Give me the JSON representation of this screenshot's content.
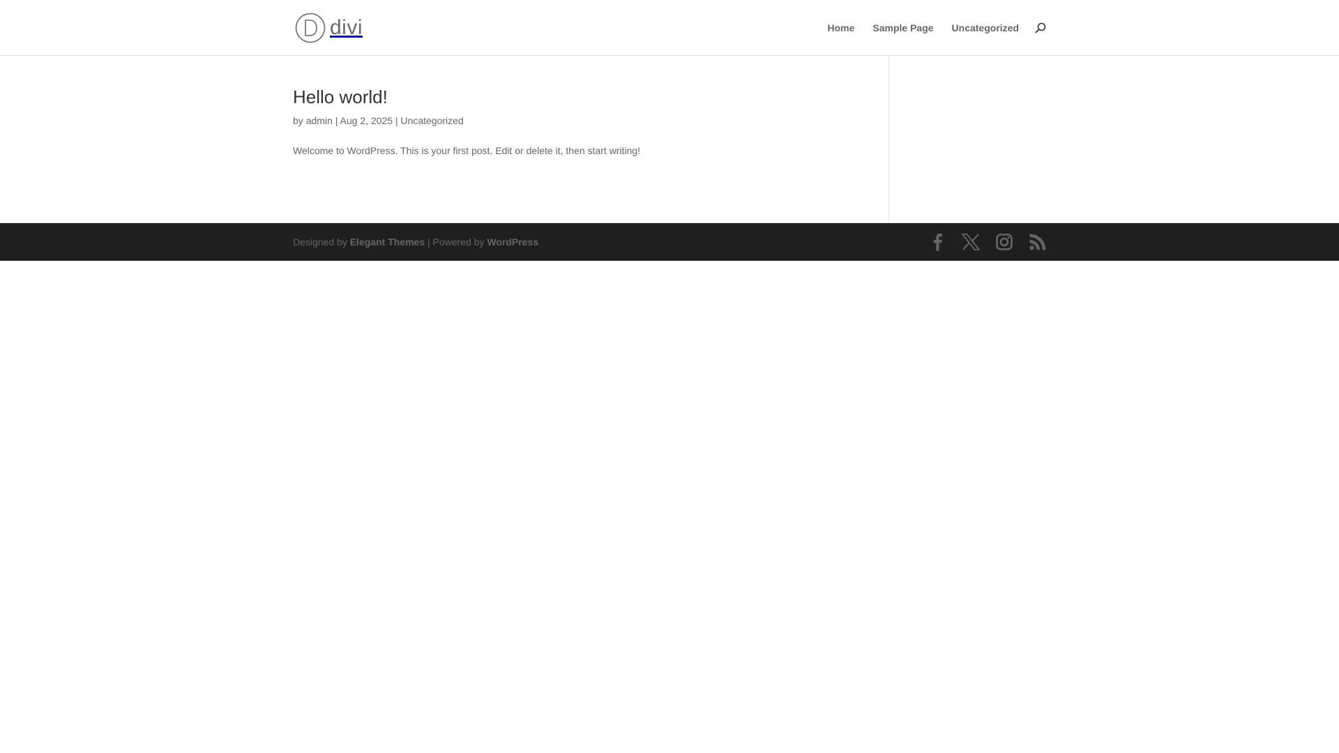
{
  "header": {
    "logo_text": "divi",
    "nav": [
      {
        "label": "Home"
      },
      {
        "label": "Sample Page"
      },
      {
        "label": "Uncategorized"
      }
    ],
    "search_icon": "search-icon"
  },
  "post": {
    "title": "Hello world!",
    "meta_by": "by",
    "author": "admin",
    "separator": "|",
    "date": "Aug 2, 2025",
    "category": "Uncategorized",
    "excerpt": "Welcome to WordPress. This is your first post. Edit or delete it, then start writing!"
  },
  "footer": {
    "designed_by": "Designed by",
    "theme_link": "Elegant Themes",
    "powered_sep": "| Powered by",
    "wp_link": "WordPress",
    "social": [
      {
        "icon": "facebook-icon"
      },
      {
        "icon": "x-twitter-icon"
      },
      {
        "icon": "instagram-icon"
      },
      {
        "icon": "rss-icon"
      }
    ]
  },
  "colors": {
    "header_bg": "#ffffff",
    "footer_bg": "#1f1f1f",
    "text": "#666666",
    "title": "#333333",
    "icon": "#666666"
  }
}
